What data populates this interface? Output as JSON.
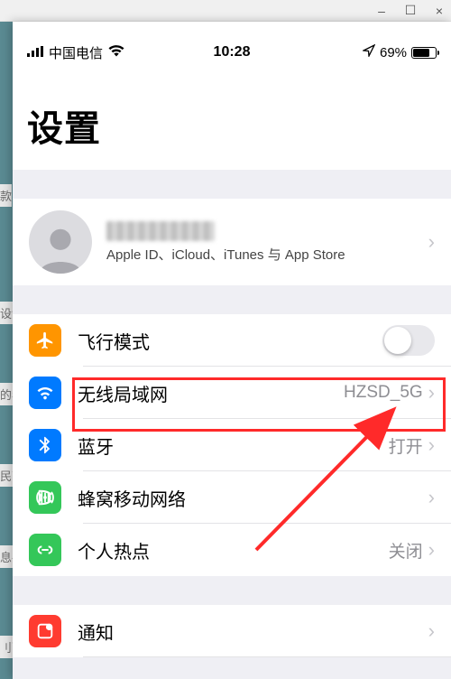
{
  "host_window": {
    "minimize": "–",
    "maximize": "☐",
    "close": "×"
  },
  "status_bar": {
    "carrier": "中国电信",
    "time": "10:28",
    "battery_pct": "69%"
  },
  "page_title": "设置",
  "account": {
    "subtitle": "Apple ID、iCloud、iTunes 与 App Store"
  },
  "rows": {
    "airplane": {
      "label": "飞行模式"
    },
    "wifi": {
      "label": "无线局域网",
      "value": "HZSD_5G"
    },
    "bluetooth": {
      "label": "蓝牙",
      "value": "打开"
    },
    "cellular": {
      "label": "蜂窝移动网络"
    },
    "hotspot": {
      "label": "个人热点",
      "value": "关闭"
    },
    "notifications": {
      "label": "通知"
    }
  },
  "colors": {
    "airplane": "#ff9500",
    "wifi": "#007aff",
    "bluetooth": "#007aff",
    "cellular": "#34c759",
    "hotspot": "#34c759",
    "notifications": "#ff3b30",
    "highlight": "#ff2a2a"
  },
  "backdrop_texts": [
    "款",
    "设?款",
    "的年",
    "民营",
    "息共",
    "刂副"
  ]
}
